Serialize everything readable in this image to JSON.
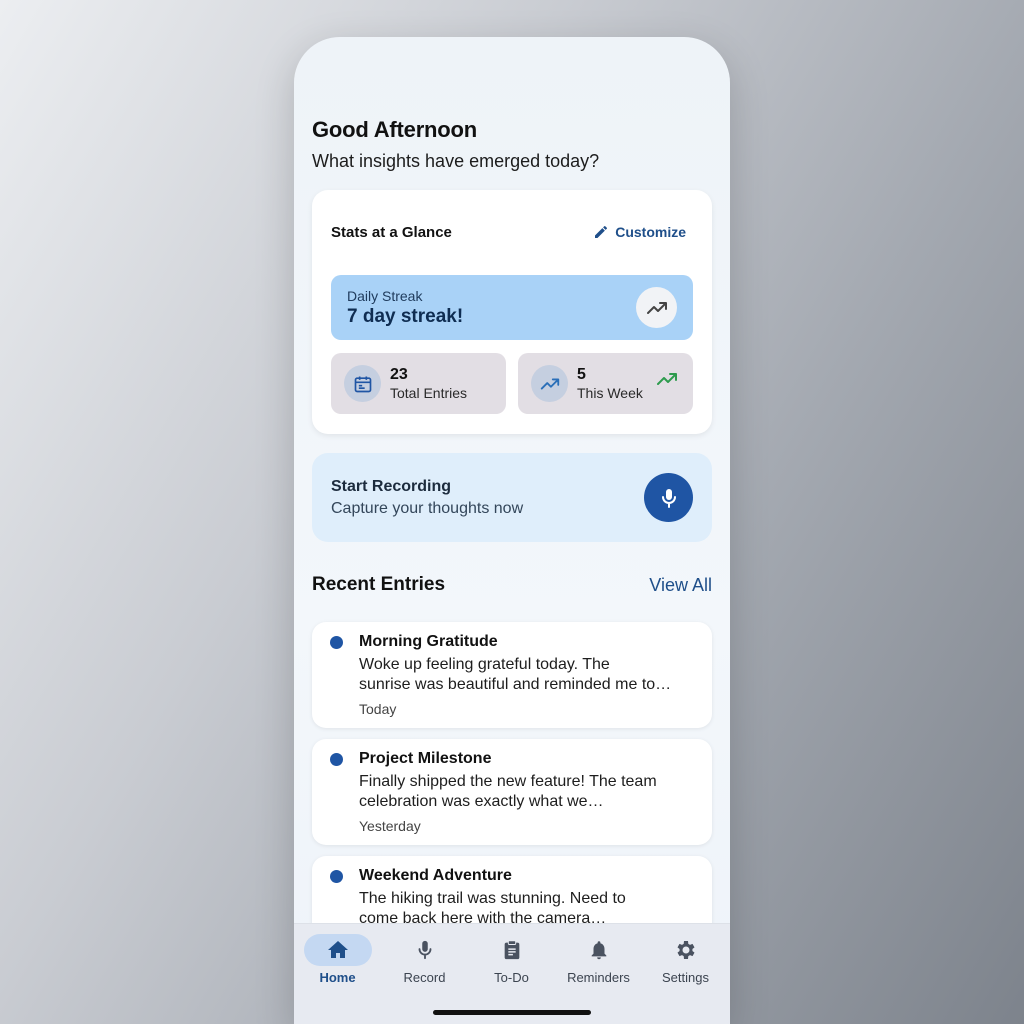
{
  "greeting": {
    "title": "Good Afternoon",
    "subtitle": "What insights have emerged today?"
  },
  "stats": {
    "title": "Stats at a Glance",
    "customize_label": "Customize",
    "streak": {
      "label": "Daily Streak",
      "value": "7 day streak!"
    },
    "total": {
      "number": "23",
      "label": "Total Entries"
    },
    "week": {
      "number": "5",
      "label": "This Week"
    }
  },
  "record": {
    "title": "Start Recording",
    "subtitle": "Capture your thoughts now"
  },
  "recent": {
    "heading": "Recent Entries",
    "view_all": "View All",
    "entries": [
      {
        "title": "Morning Gratitude",
        "line1": "Woke up feeling grateful today. The",
        "line2": "sunrise was beautiful and reminded me to…",
        "date": "Today"
      },
      {
        "title": "Project Milestone",
        "line1": "Finally shipped the new feature! The team",
        "line2": "celebration was exactly what we…",
        "date": "Yesterday"
      },
      {
        "title": "Weekend Adventure",
        "line1": "The hiking trail was stunning. Need to",
        "line2": "come back here with the camera…",
        "date": ""
      }
    ]
  },
  "tabs": [
    {
      "label": "Home",
      "icon": "home-icon",
      "active": true
    },
    {
      "label": "Record",
      "icon": "mic-icon",
      "active": false
    },
    {
      "label": "To-Do",
      "icon": "clipboard-icon",
      "active": false
    },
    {
      "label": "Reminders",
      "icon": "bell-icon",
      "active": false
    },
    {
      "label": "Settings",
      "icon": "gear-icon",
      "active": false
    }
  ],
  "colors": {
    "accent": "#1f55a4",
    "link": "#1f4f8a",
    "streak_bg": "#a9d2f7",
    "record_bg": "#dfeefb",
    "trend_green": "#2e9b4e"
  }
}
